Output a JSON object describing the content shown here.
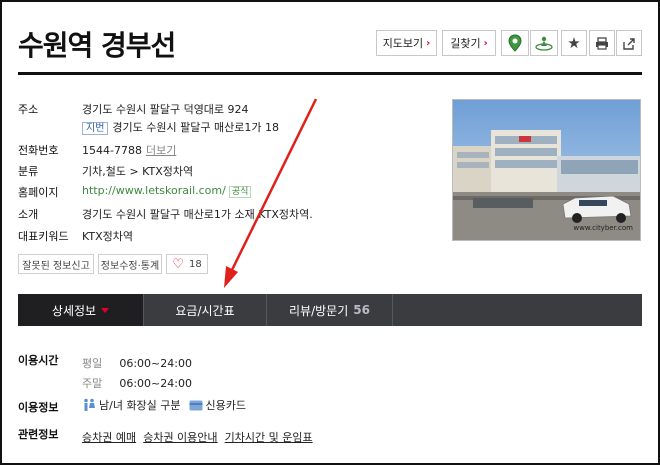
{
  "title": "수원역 경부선",
  "toolbar": {
    "map_label": "지도보기",
    "directions_label": "길찾기",
    "arrow": "›",
    "icons": [
      "map-pin-icon",
      "street-view-icon",
      "star-icon",
      "print-icon",
      "share-icon"
    ]
  },
  "info": {
    "address_label": "주소",
    "address": "경기도 수원시 팔달구 덕영대로 924",
    "jibun_tag": "지번",
    "jibun_address": "경기도 수원시 팔달구 매산로1가 18",
    "phone_label": "전화번호",
    "phone": "1544-7788",
    "phone_more": "더보기",
    "category_label": "분류",
    "category": "기차,철도 > KTX정차역",
    "homepage_label": "홈페이지",
    "homepage": "http://www.letskorail.com/",
    "homepage_badge": "공식",
    "intro_label": "소개",
    "intro": "경기도 수원시 팔달구 매산로1가 소재 KTX정차역.",
    "keyword_label": "대표키워드",
    "keyword": "KTX정차역"
  },
  "actions": {
    "report_label": "잘못된 정보신고",
    "edit_label": "정보수정·통계",
    "like_count": "18"
  },
  "photo": {
    "watermark": "www.cityber.com"
  },
  "tabs": [
    {
      "label": "상세정보"
    },
    {
      "label": "요금/시간표"
    },
    {
      "label": "리뷰/방문기",
      "count": "56"
    }
  ],
  "details": {
    "hours_label": "이용시간",
    "weekday_label": "평일",
    "weekday_time": "06:00~24:00",
    "weekend_label": "주말",
    "weekend_time": "06:00~24:00",
    "facility_label": "이용정보",
    "facility_restroom": "남/녀 화장실 구분",
    "facility_card": "신용카드",
    "related_label": "관련정보",
    "related_links": [
      "승차권 예매",
      "승차권 이용안내",
      "기차시간 및 운임표"
    ]
  },
  "colors": {
    "accent": "#e4002b",
    "tab_bg": "#3a3c40",
    "tab_active": "#1f1f22",
    "link_green": "#3e8a3e"
  }
}
